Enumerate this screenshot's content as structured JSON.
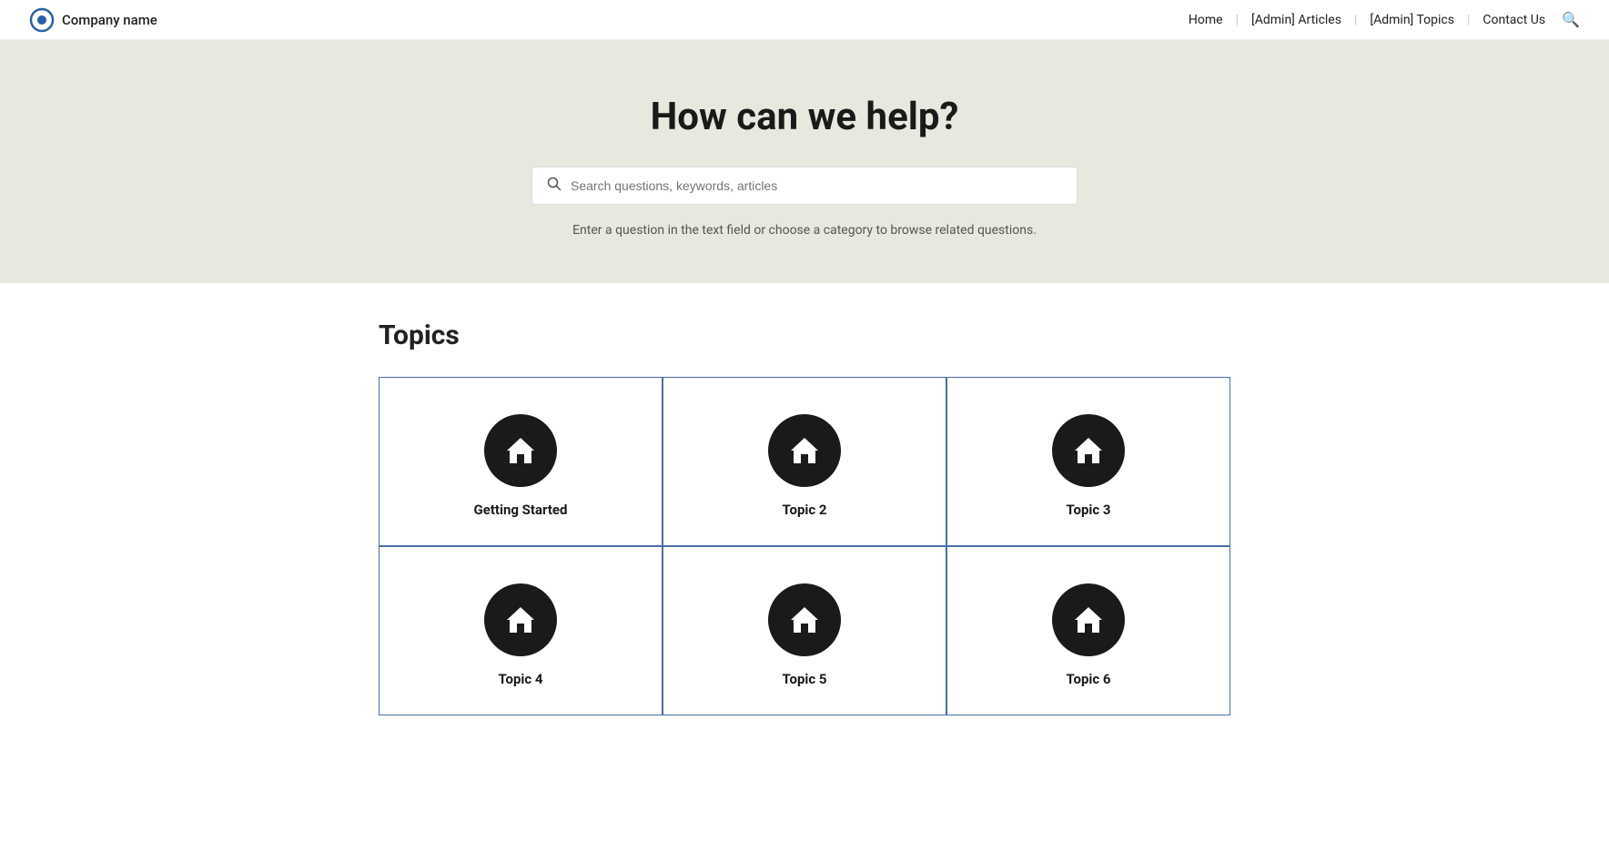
{
  "brand": {
    "name": "Company name"
  },
  "navbar": {
    "links": [
      {
        "label": "Home",
        "name": "nav-home"
      },
      {
        "label": "[Admin] Articles",
        "name": "nav-admin-articles"
      },
      {
        "label": "[Admin] Topics",
        "name": "nav-admin-topics"
      },
      {
        "label": "Contact Us",
        "name": "nav-contact-us"
      }
    ]
  },
  "hero": {
    "title": "How can we help?",
    "search_placeholder": "Search questions, keywords, articles",
    "hint": "Enter a question in the text field or choose a category to browse related questions."
  },
  "topics_section": {
    "heading": "Topics",
    "topics": [
      {
        "id": "topic-1",
        "label": "Getting Started"
      },
      {
        "id": "topic-2",
        "label": "Topic 2"
      },
      {
        "id": "topic-3",
        "label": "Topic 3"
      },
      {
        "id": "topic-4",
        "label": "Topic 4"
      },
      {
        "id": "topic-5",
        "label": "Topic 5"
      },
      {
        "id": "topic-6",
        "label": "Topic 6"
      }
    ]
  }
}
